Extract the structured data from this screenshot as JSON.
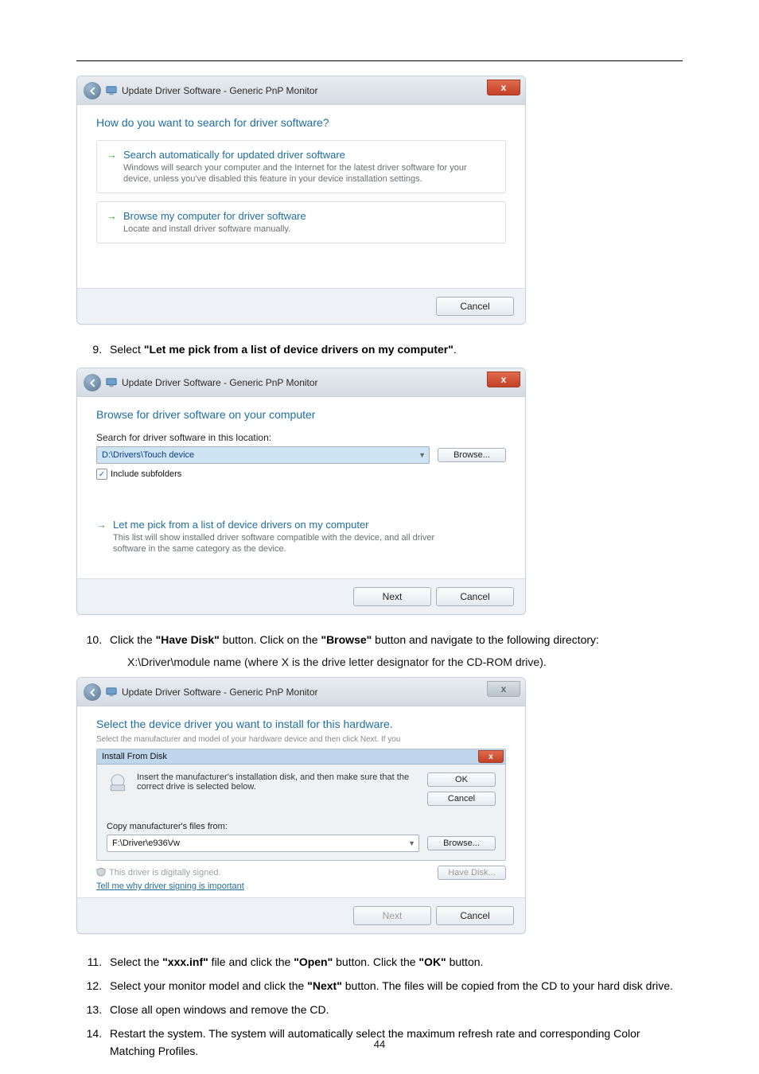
{
  "page_number": "44",
  "dialog1": {
    "title": "Update Driver Software - Generic PnP Monitor",
    "heading": "How do you want to search for driver software?",
    "opt1_title": "Search automatically for updated driver software",
    "opt1_sub": "Windows will search your computer and the Internet for the latest driver software for your device, unless you've disabled this feature in your device installation settings.",
    "opt2_title": "Browse my computer for driver software",
    "opt2_sub": "Locate and install driver software manually.",
    "cancel": "Cancel"
  },
  "step9": {
    "prefix": "Select ",
    "bold": "\"Let me pick from a list of device drivers on my computer\"",
    "suffix": "."
  },
  "dialog2": {
    "title": "Update Driver Software - Generic PnP Monitor",
    "heading": "Browse for driver software on your computer",
    "search_label": "Search for driver software in this location:",
    "path_value": "D:\\Drivers\\Touch device",
    "browse": "Browse...",
    "include": "Include subfolders",
    "pick_title": "Let me pick from a list of device drivers on my computer",
    "pick_sub": "This list will show installed driver software compatible with the device, and all driver software in the same category as the device.",
    "next": "Next",
    "cancel": "Cancel"
  },
  "step10": {
    "line1_a": "Click the ",
    "line1_b": "\"Have Disk\"",
    "line1_c": " button. Click on the ",
    "line1_d": "\"Browse\"",
    "line1_e": " button and navigate to the following directory:",
    "line2": "X:\\Driver\\module name (where X is the drive letter designator for the CD-ROM drive)."
  },
  "dialog3": {
    "title": "Update Driver Software - Generic PnP Monitor",
    "heading": "Select the device driver you want to install for this hardware.",
    "top_tiny": "Select the manufacturer and model of your hardware device and then click Next. If you",
    "install_from_disk": "Install From Disk",
    "instr": "Insert the manufacturer's installation disk, and then make sure that the correct drive is selected below.",
    "ok": "OK",
    "cancel": "Cancel",
    "copy_label": "Copy manufacturer's files from:",
    "copy_value": "F:\\Driver\\e936Vw",
    "browse": "Browse...",
    "signed": "This driver is digitally signed.",
    "tell_me": "Tell me why driver signing is important",
    "have_disk": "Have Disk...",
    "next": "Next",
    "footer_cancel": "Cancel"
  },
  "step11": {
    "a": "Select the ",
    "b": "\"xxx.inf\"",
    "c": " file and click the ",
    "d": "\"Open\"",
    "e": " button. Click the ",
    "f": "\"OK\"",
    "g": " button."
  },
  "step12": {
    "a": "Select your monitor model and click the ",
    "b": "\"Next\"",
    "c": " button. The files will be copied from the CD to your hard disk drive."
  },
  "step13": "Close all open windows and remove the CD.",
  "step14": "Restart the system. The system will automatically select the maximum refresh rate and corresponding Color Matching Profiles."
}
